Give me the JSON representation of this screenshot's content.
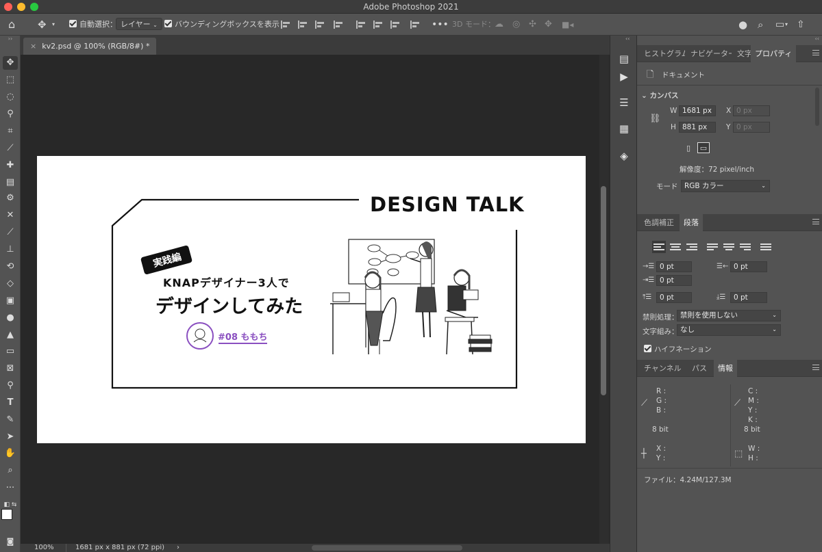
{
  "window": {
    "title": "Adobe Photoshop 2021"
  },
  "options_bar": {
    "auto_select_label": "自動選択：",
    "auto_select_target": "レイヤー",
    "bounding_box_label": "バウンディングボックスを表示",
    "mode_3d_label": "3D モード："
  },
  "document": {
    "tab_title": "kv2.psd @ 100% (RGB/8#) *",
    "zoom": "100%",
    "dimensions": "1681 px x 881 px (72 ppi)"
  },
  "artwork": {
    "headline": "DESIGN TALK",
    "badge": "実践編",
    "subtitle": "KNAPデザイナー3人で",
    "title": "デザインしてみた",
    "author": "#08 ももち"
  },
  "properties_panel": {
    "tabs": [
      "ヒストグラム",
      "ナビゲーター",
      "文字",
      "プロパティ"
    ],
    "active_tab": "プロパティ",
    "doc_label": "ドキュメント",
    "canvas_section": "カンバス",
    "w_label": "W",
    "w_value": "1681 px",
    "h_label": "H",
    "h_value": "881 px",
    "x_label": "X",
    "x_placeholder": "0 px",
    "y_label": "Y",
    "y_placeholder": "0 px",
    "resolution": "解像度：72 pixel/inch",
    "mode_label": "モード",
    "mode_value": "RGB カラー"
  },
  "paragraph_panel": {
    "tabs": [
      "色調補正",
      "段落"
    ],
    "indent_left": "0 pt",
    "indent_right": "0 pt",
    "indent_first": "0 pt",
    "space_before": "0 pt",
    "space_after": "0 pt",
    "kinsoku_label": "禁則処理：",
    "kinsoku_value": "禁則を使用しない",
    "mojikumi_label": "文字組み：",
    "mojikumi_value": "なし",
    "hyphenation_label": "ハイフネーション"
  },
  "info_panel": {
    "tabs": [
      "チャンネル",
      "パス",
      "情報"
    ],
    "rgb": [
      "R :",
      "G :",
      "B :"
    ],
    "cmyk": [
      "C :",
      "M :",
      "Y :",
      "K :"
    ],
    "bit_left": "8 bit",
    "bit_right": "8 bit",
    "xy": [
      "X :",
      "Y :"
    ],
    "wh": [
      "W :",
      "H :"
    ],
    "file_size": "ファイル：4.24M/127.3M"
  }
}
